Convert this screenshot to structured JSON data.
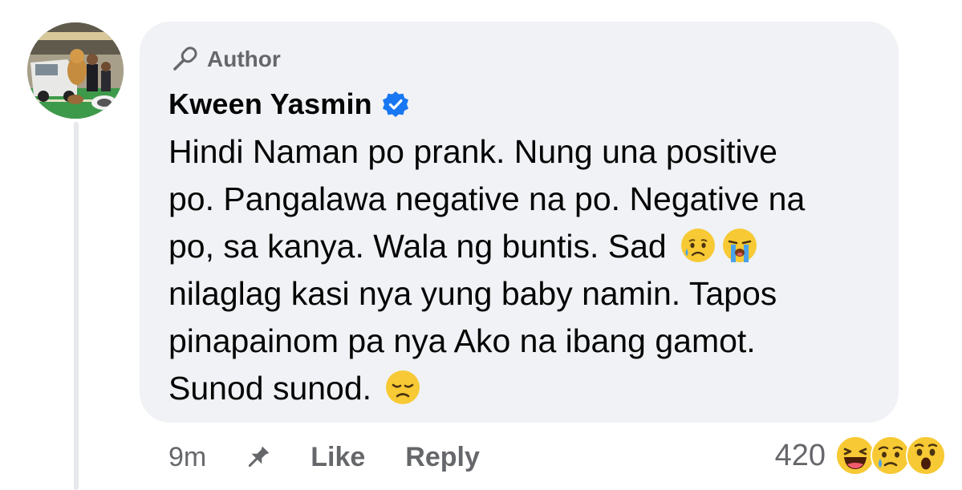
{
  "header": {
    "badge_label": "Author",
    "commenter_name": "Kween Yasmin"
  },
  "comment": {
    "lines": [
      "Hindi Naman po prank. Nung una positive",
      "po. Pangalawa negative na po. Negative na",
      "po, sa kanya. Wala ng buntis. Sad",
      "nilaglag kasi nya yung baby namin. Tapos",
      "pinapainom pa nya Ako na ibang gamot.",
      "Sunod sunod."
    ],
    "inline_emojis": [
      "sad-but-relieved-emoji",
      "loudly-crying-emoji",
      "disappointed-emoji"
    ]
  },
  "footer": {
    "timestamp": "9m",
    "like_label": "Like",
    "reply_label": "Reply",
    "reaction_count": "420",
    "reaction_icons": [
      "haha-reaction-icon",
      "sad-reaction-icon",
      "wow-reaction-icon"
    ]
  },
  "colors": {
    "bubble_bg": "#f0f2f5",
    "secondary_text": "#65676b",
    "verified_blue": "#1877f2",
    "emoji_yellow": "#f7c934"
  }
}
